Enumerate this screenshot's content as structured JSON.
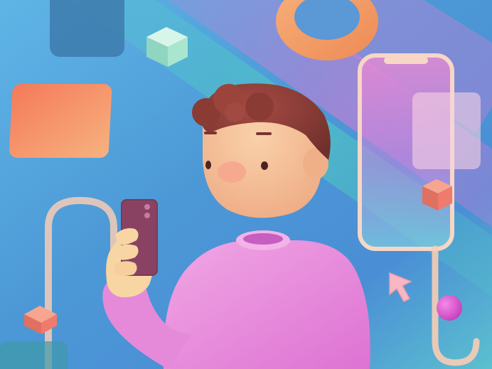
{
  "scene": {
    "palette": {
      "bg_blue": "#4f9fd8",
      "bg_teal": "#4fb7c9",
      "bg_pink": "#e07ad6",
      "sweater": "#e58ad9",
      "skin": "#f3c29a",
      "hair": "#8a3b34",
      "phone_device": "#7b3a57",
      "orange_card": "#f5946d",
      "ring_orange": "#f4a36a",
      "mint_cube": "#a9e5cf",
      "coral_cube": "#ef7a6e",
      "ball_magenta": "#d94cc6",
      "tube_peach": "#f7cdb5",
      "cursor_pink": "#f7b7c3"
    },
    "elements": [
      "background-gradient",
      "floating-phone-frame-icon",
      "cursor-arrow-icon",
      "orange-ring-torus",
      "mint-cube",
      "coral-cube",
      "magenta-ball",
      "peach-tube-loop",
      "orange-rounded-card",
      "dark-rounded-tile",
      "person-character",
      "handheld-phone"
    ]
  }
}
